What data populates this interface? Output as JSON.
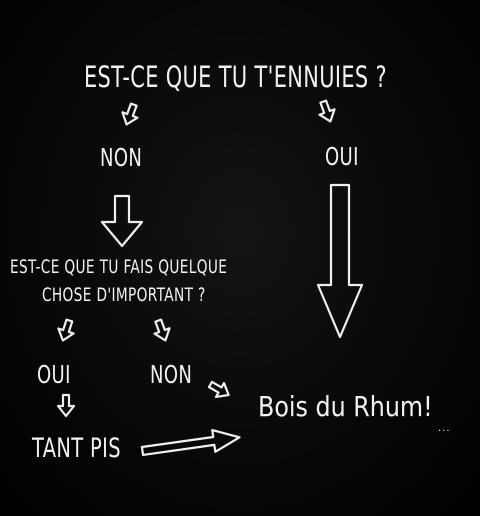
{
  "question_1": "EST-CE QUE TU T'ENNUIES ?",
  "answer_no_1": "NON",
  "answer_yes_1": "OUI",
  "question_2_line1": "EST-CE QUE TU FAIS QUELQUE",
  "question_2_line2": "CHOSE D'IMPORTANT ?",
  "answer_yes_2": "OUI",
  "answer_no_2": "NON",
  "result_too_bad": "TANT PIS",
  "result_drink": "Bois du Rhum!",
  "result_drink_dots": "...",
  "colors": {
    "background": "#050505",
    "chalk": "#f2f2f2"
  }
}
